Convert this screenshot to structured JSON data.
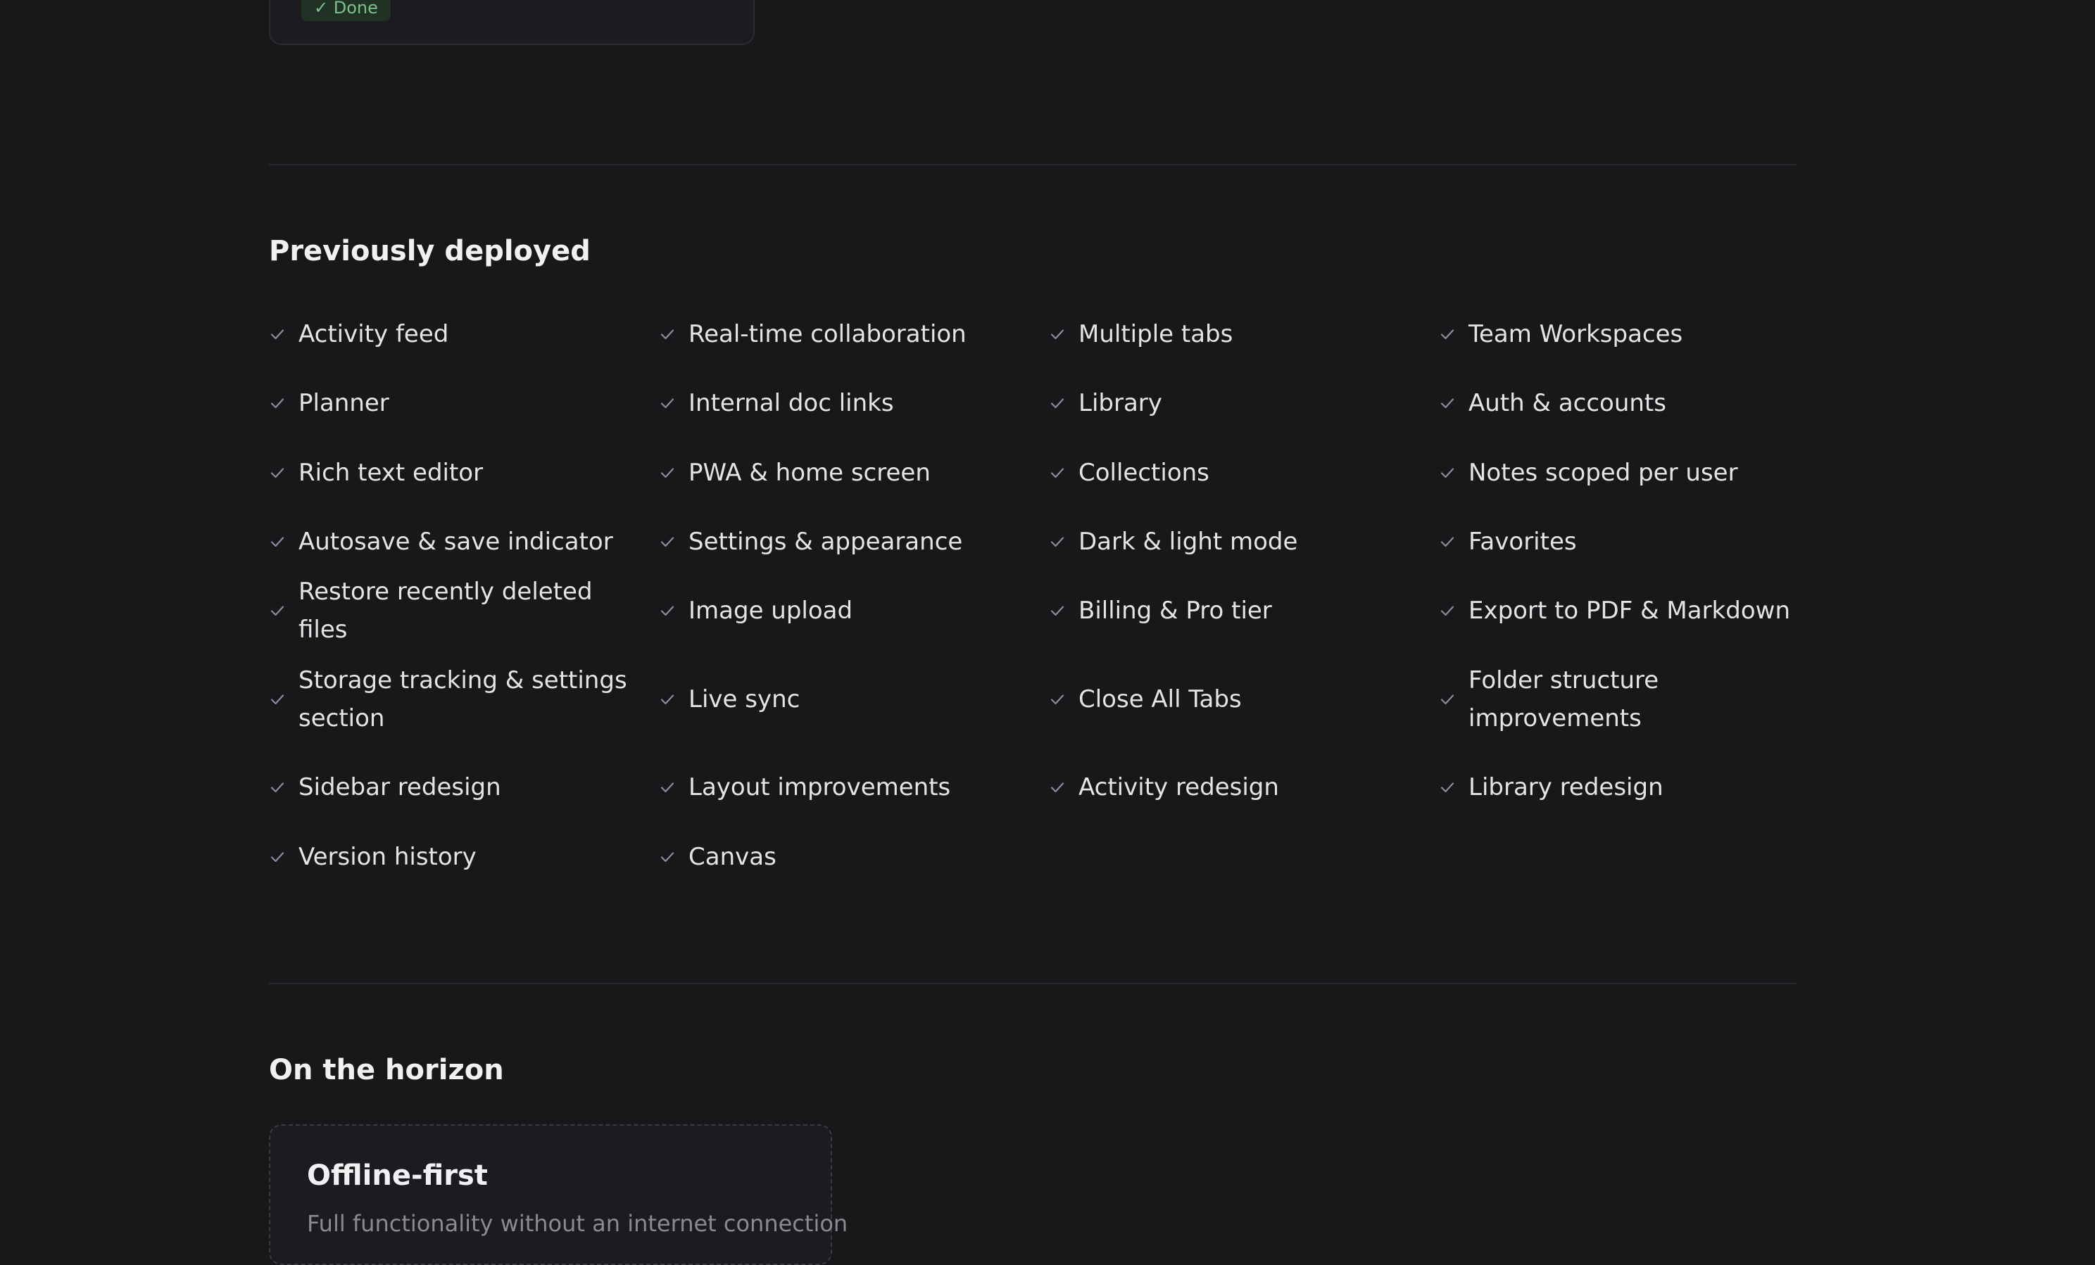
{
  "shipped_card": {
    "badge": "✓ Done"
  },
  "previously_deployed": {
    "title": "Previously deployed",
    "items": [
      "Activity feed",
      "Real-time collaboration",
      "Multiple tabs",
      "Team Workspaces",
      "Planner",
      "Internal doc links",
      "Library",
      "Auth & accounts",
      "Rich text editor",
      "PWA & home screen",
      "Collections",
      "Notes scoped per user",
      "Autosave & save indicator",
      "Settings & appearance",
      "Dark & light mode",
      "Favorites",
      "Restore recently deleted files",
      "Image upload",
      "Billing & Pro tier",
      "Export to PDF & Markdown",
      "Storage tracking & settings section",
      "Live sync",
      "Close All Tabs",
      "Folder structure improvements",
      "Sidebar redesign",
      "Layout improvements",
      "Activity redesign",
      "Library redesign",
      "Version history",
      "Canvas"
    ]
  },
  "on_the_horizon": {
    "title": "On the horizon",
    "cards": [
      {
        "title": "Offline-first",
        "description": "Full functionality without an internet connection"
      }
    ]
  },
  "colors": {
    "background": "#18181b",
    "card_background": "#1c1c20",
    "border": "#2c2c31",
    "check_icon": "#8c8ca0",
    "done_badge_bg": "#203126",
    "done_badge_text": "#7fbf8c"
  }
}
